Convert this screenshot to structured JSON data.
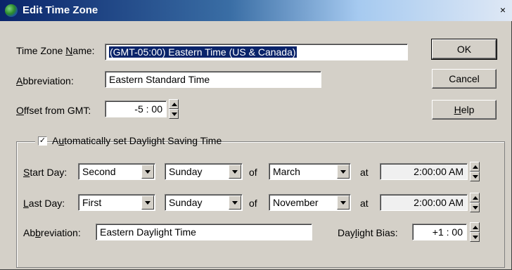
{
  "window": {
    "title": "Edit Time Zone",
    "close_glyph": "×"
  },
  "fields": {
    "time_zone_name": {
      "label_pre": "Time Zone ",
      "label_ul": "N",
      "label_post": "ame:",
      "value": "(GMT-05:00) Eastern Time (US & Canada)"
    },
    "abbreviation": {
      "label_pre": "",
      "label_ul": "A",
      "label_post": "bbreviation:",
      "value": "Eastern Standard Time"
    },
    "offset": {
      "label_pre": "",
      "label_ul": "O",
      "label_post": "ffset from GMT:",
      "hours": "-5",
      "sep": ":",
      "minutes": "00"
    }
  },
  "buttons": {
    "ok": "OK",
    "cancel": "Cancel",
    "help_ul": "H",
    "help_post": "elp"
  },
  "dst": {
    "checked": true,
    "check_glyph": "✓",
    "label_pre": "A",
    "label_ul": "u",
    "label_post": "tomatically set Daylight Saving Time",
    "start": {
      "label_ul": "S",
      "label_post": "tart Day:",
      "week": "Second",
      "day": "Sunday",
      "of": "of",
      "month": "March",
      "at": "at",
      "h": "2",
      "m": "00",
      "s": "00",
      "ampm": "AM"
    },
    "last": {
      "label_ul": "L",
      "label_post": "ast Day:",
      "week": "First",
      "day": "Sunday",
      "of": "of",
      "month": "November",
      "at": "at",
      "h": "2",
      "m": "00",
      "s": "00",
      "ampm": "AM"
    },
    "abbreviation": {
      "label_pre": "Ab",
      "label_ul": "b",
      "label_post": "reviation:",
      "value": "Eastern Daylight Time"
    },
    "bias": {
      "label_pre": "Day",
      "label_ul": "l",
      "label_post": "ight Bias:",
      "hours": "+1",
      "sep": ":",
      "minutes": "00"
    }
  }
}
